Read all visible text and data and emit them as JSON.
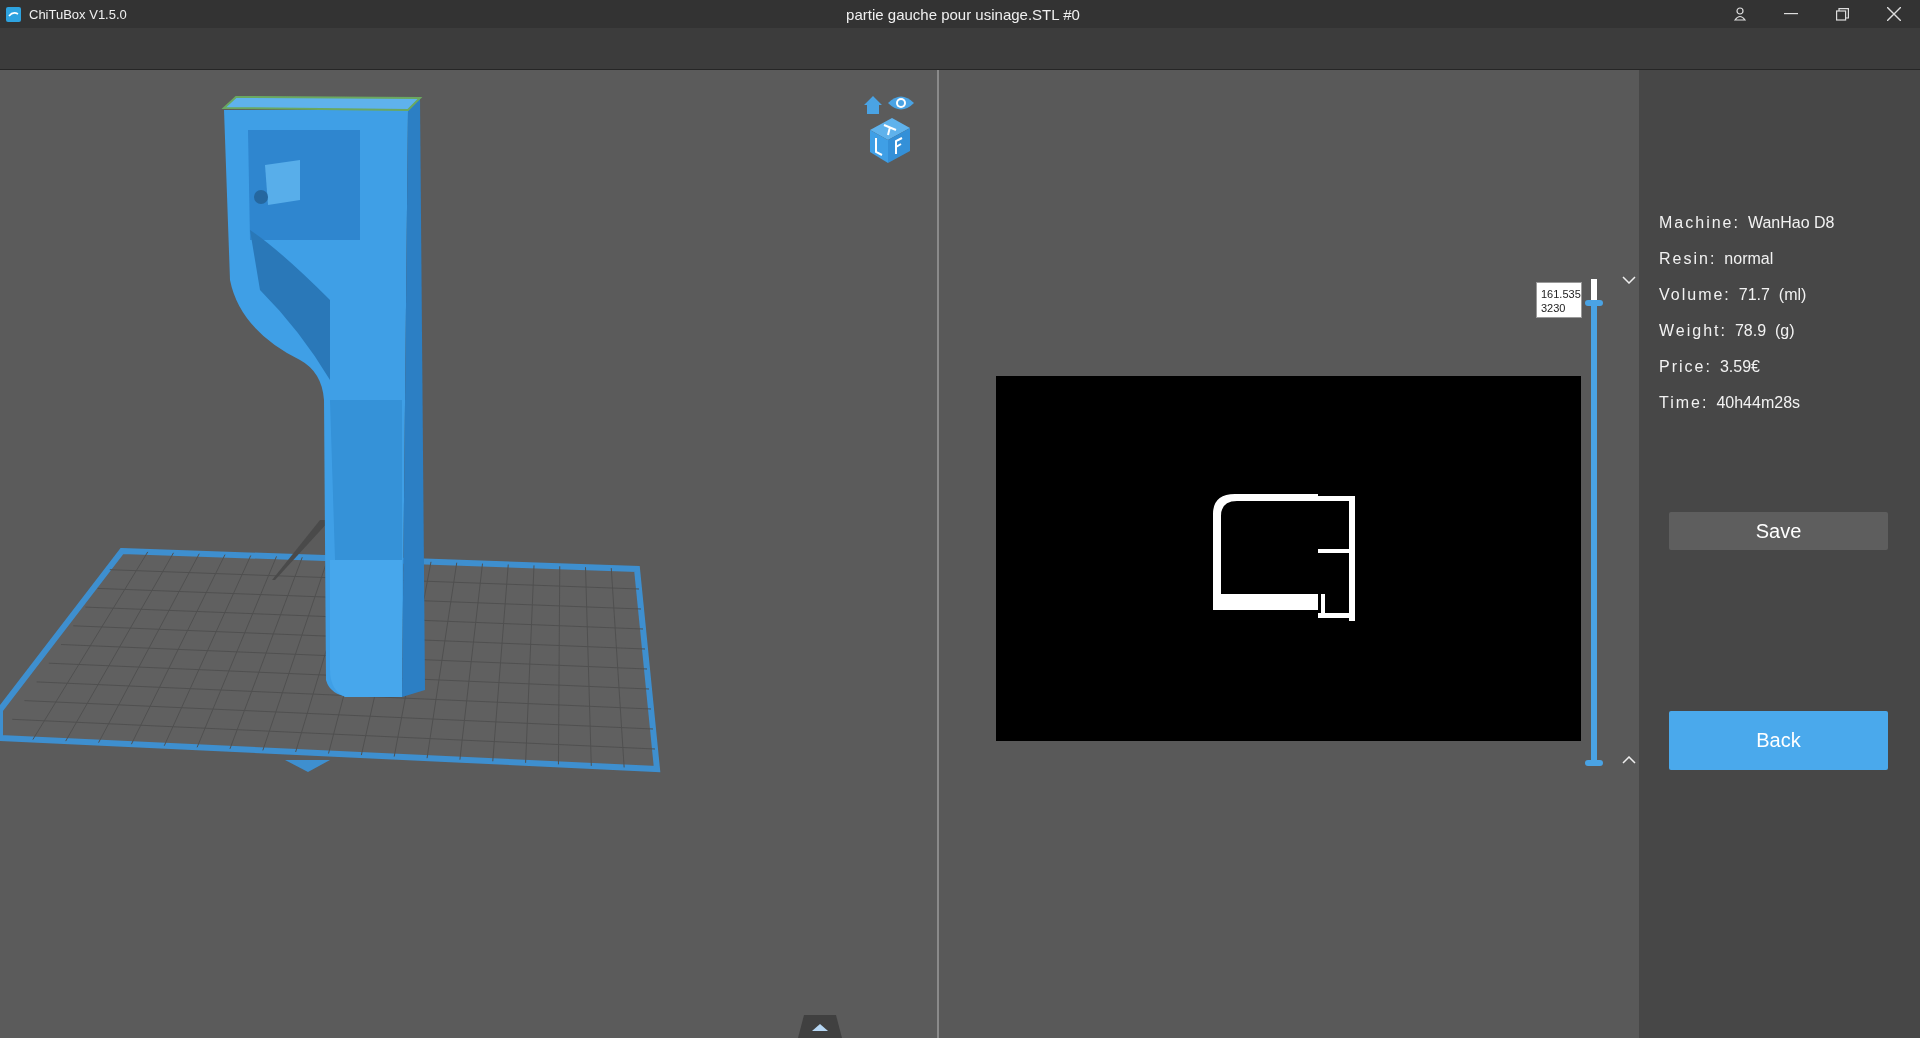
{
  "window": {
    "app_title": "ChiTuBox V1.5.0",
    "document_title": "partie gauche pour usinage.STL #0"
  },
  "layer_slider": {
    "height_label": "161.535",
    "layer_label": "3230",
    "level": 0.95
  },
  "info": [
    {
      "label": "Machine:",
      "value": "WanHao D8"
    },
    {
      "label": "Resin:",
      "value": "normal"
    },
    {
      "label": "Volume:",
      "value": "71.7  (ml)"
    },
    {
      "label": "Weight:",
      "value": "78.9  (g)"
    },
    {
      "label": "Price:",
      "value": "3.59€"
    },
    {
      "label": "Time:",
      "value": "40h44m28s"
    }
  ],
  "buttons": [
    {
      "label": "Save",
      "kind": "secondary"
    },
    {
      "label": "Back",
      "kind": "primary"
    }
  ]
}
